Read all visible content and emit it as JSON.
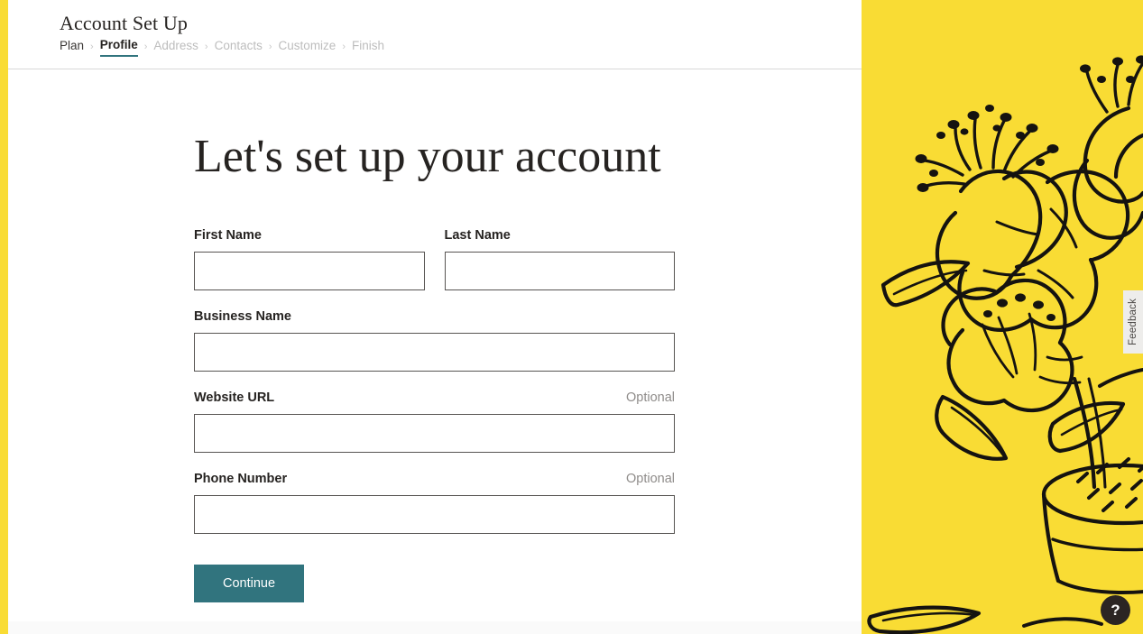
{
  "colors": {
    "accent_yellow": "#f9dc34",
    "accent_teal": "#31747e",
    "ink": "#262321",
    "muted": "#bdbdbd",
    "optional_gray": "#8f8c8a",
    "feedback_bg": "#eeedeb",
    "help_bg": "#2b2523"
  },
  "header": {
    "title": "Account Set Up",
    "breadcrumb": [
      {
        "label": "Plan",
        "state": "done"
      },
      {
        "label": "Profile",
        "state": "current"
      },
      {
        "label": "Address",
        "state": "upcoming"
      },
      {
        "label": "Contacts",
        "state": "upcoming"
      },
      {
        "label": "Customize",
        "state": "upcoming"
      },
      {
        "label": "Finish",
        "state": "upcoming"
      }
    ],
    "separator": "›"
  },
  "main": {
    "headline": "Let's set up your account",
    "fields": [
      {
        "label": "First Name",
        "value": "",
        "placeholder": "",
        "optional": ""
      },
      {
        "label": "Last Name",
        "value": "",
        "placeholder": "",
        "optional": ""
      },
      {
        "label": "Business Name",
        "value": "",
        "placeholder": "",
        "optional": ""
      },
      {
        "label": "Website URL",
        "value": "",
        "placeholder": "",
        "optional": "Optional"
      },
      {
        "label": "Phone Number",
        "value": "",
        "placeholder": "",
        "optional": "Optional"
      }
    ],
    "submit_label": "Continue"
  },
  "widgets": {
    "feedback_label": "Feedback",
    "help_label": "?"
  },
  "illustration": {
    "subject": "hand-drawn lily flowers in a pot",
    "background": "#f9dc34",
    "ink": "#151310"
  }
}
